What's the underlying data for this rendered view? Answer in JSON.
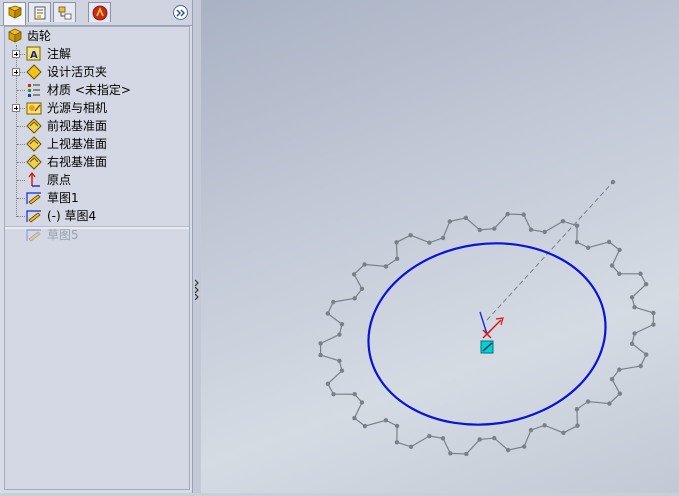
{
  "feature_manager": {
    "tabs": [
      {
        "icon": "feature-tree-icon",
        "active": true
      },
      {
        "icon": "property-manager-icon",
        "active": false
      },
      {
        "icon": "configuration-manager-icon",
        "active": false
      },
      {
        "icon": "appearance-icon",
        "active": false
      }
    ],
    "expand_icon": "double-chevron-right-icon",
    "tree": {
      "root": {
        "label": "齿轮",
        "icon": "part-icon"
      },
      "items": [
        {
          "label": "注解",
          "icon": "annotations-icon",
          "expandable": true
        },
        {
          "label": "设计活页夹",
          "icon": "design-binder-icon",
          "expandable": true
        },
        {
          "label": "材质 <未指定>",
          "icon": "material-icon",
          "expandable": false
        },
        {
          "label": "光源与相机",
          "icon": "lights-cameras-icon",
          "expandable": true
        },
        {
          "label": "前视基准面",
          "icon": "plane-icon",
          "expandable": false
        },
        {
          "label": "上视基准面",
          "icon": "plane-icon",
          "expandable": false
        },
        {
          "label": "右视基准面",
          "icon": "plane-icon",
          "expandable": false
        },
        {
          "label": "原点",
          "icon": "origin-icon",
          "expandable": false
        },
        {
          "label": "草图1",
          "icon": "sketch-icon",
          "expandable": false
        },
        {
          "label": "(-) 草图4",
          "icon": "sketch-icon",
          "expandable": false
        }
      ],
      "rolled_back": [
        {
          "label": "草图5",
          "icon": "sketch-icon"
        }
      ]
    }
  },
  "colors": {
    "sketch_circle": "#0a14d8",
    "construction_geometry": "#7a7f88",
    "origin_x": "#e01010",
    "origin_y": "#1030e0",
    "point_marker": "#00d0d8"
  },
  "viewport": {
    "gear": {
      "teeth": 18
    }
  }
}
